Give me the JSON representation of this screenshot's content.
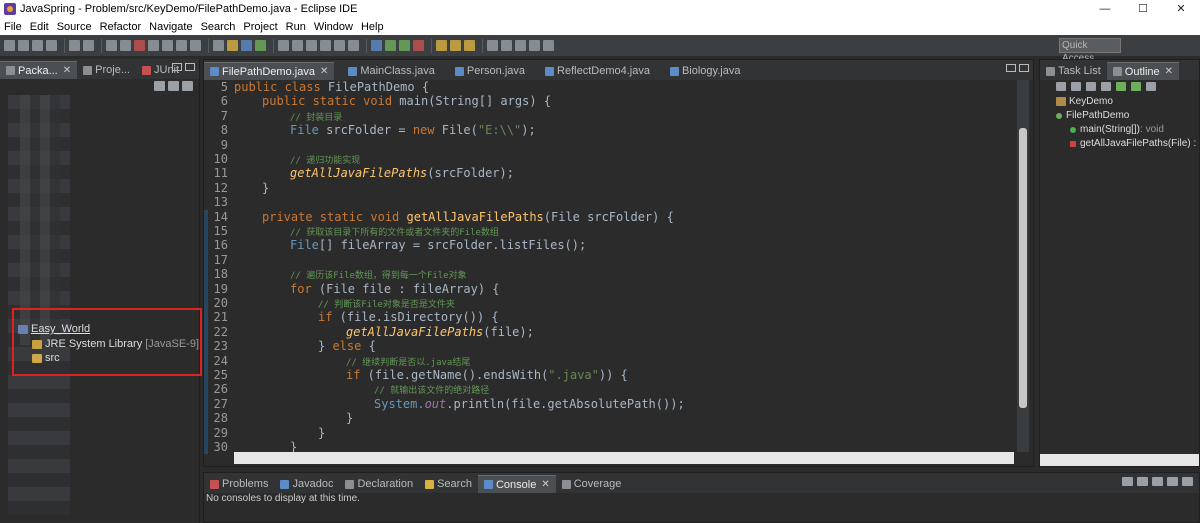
{
  "window": {
    "title": "JavaSpring - Problem/src/KeyDemo/FilePathDemo.java - Eclipse IDE",
    "minimize": "—",
    "maximize": "☐",
    "close": "✕"
  },
  "menu": [
    "File",
    "Edit",
    "Source",
    "Refactor",
    "Navigate",
    "Search",
    "Project",
    "Run",
    "Window",
    "Help"
  ],
  "quick_access": "Quick Access",
  "left_panel": {
    "tabs": [
      {
        "label": "Packa...",
        "active": true,
        "close": "✕"
      },
      {
        "label": "Proje..."
      },
      {
        "label": "JUnit"
      }
    ],
    "tree": {
      "project": "Easy_World",
      "jre": "JRE System Library",
      "jre_version": "[JavaSE-9]",
      "src": "src"
    }
  },
  "editor": {
    "tabs": [
      {
        "label": "FilePathDemo.java",
        "active": true,
        "close": "✕"
      },
      {
        "label": "MainClass.java"
      },
      {
        "label": "Person.java"
      },
      {
        "label": "ReflectDemo4.java"
      },
      {
        "label": "Biology.java"
      }
    ],
    "line_numbers": [
      "5",
      "6",
      "7",
      "8",
      "9",
      "10",
      "11",
      "12",
      "13",
      "14",
      "15",
      "16",
      "17",
      "18",
      "19",
      "20",
      "21",
      "22",
      "23",
      "24",
      "25",
      "26",
      "27",
      "28",
      "29",
      "30"
    ],
    "code": {
      "l5_kw": "public class ",
      "l5_cls": "FilePathDemo",
      "l5_rest": " {",
      "l6_kw": "public static void ",
      "l6_fn": "main",
      "l6_rest": "(String[] args) {",
      "l7_cm": "// 封装目录",
      "l8_ty": "File",
      "l8_rest": " srcFolder = ",
      "l8_kw": "new",
      "l8_rest2": " File(",
      "l8_str": "\"E:\\\\\"",
      "l8_end": ");",
      "l10_cm": "// 递归功能实现",
      "l11_mi": "getAllJavaFilePaths",
      "l11_rest": "(srcFolder);",
      "l12": "}",
      "l14_kw": "private static void ",
      "l14_fn": "getAllJavaFilePaths",
      "l14_rest": "(File srcFolder) {",
      "l15_cm": "// 获取该目录下所有的文件或者文件夹的File数组",
      "l16_ty": "File",
      "l16_rest": "[] fileArray = srcFolder.listFiles();",
      "l18_cm": "// 遍历该File数组，得到每一个File对象",
      "l19_kw": "for",
      "l19_rest": " (File file : fileArray) {",
      "l20_cm": "// 判断该File对象是否是文件夹",
      "l21_kw": "if",
      "l21_rest": " (file.isDirectory()) {",
      "l22_mi": "getAllJavaFilePaths",
      "l22_rest": "(file);",
      "l23_b": "} ",
      "l23_kw": "else",
      "l23_rest": " {",
      "l24_cm": "// 继续判断是否以.java结尾",
      "l25_kw": "if",
      "l25_rest": " (file.getName().endsWith(",
      "l25_str": "\".java\"",
      "l25_end": ")) {",
      "l26_cm": "// 就输出该文件的绝对路径",
      "l27_a": "System.",
      "l27_sf": "out",
      "l27_rest": ".println(file.getAbsolutePath());",
      "l28": "}",
      "l29": "}",
      "l30": "}"
    }
  },
  "outline_panel": {
    "tabs": [
      {
        "label": "Task List"
      },
      {
        "label": "Outline",
        "active": true,
        "close": "✕"
      }
    ],
    "items": {
      "package": "KeyDemo",
      "class": "FilePathDemo",
      "m1": "main(String[])",
      "m1_sig": " : void",
      "m2": "getAllJavaFilePaths(File) :"
    }
  },
  "console_panel": {
    "tabs": [
      {
        "label": "Problems"
      },
      {
        "label": "Javadoc"
      },
      {
        "label": "Declaration"
      },
      {
        "label": "Search"
      },
      {
        "label": "Console",
        "active": true,
        "close": "✕"
      },
      {
        "label": "Coverage"
      }
    ],
    "message": "No consoles to display at this time."
  },
  "colors": {
    "highlight_box": "#dd2222",
    "keyword": "#cc7832",
    "comment": "#629755",
    "string": "#6a8759"
  }
}
